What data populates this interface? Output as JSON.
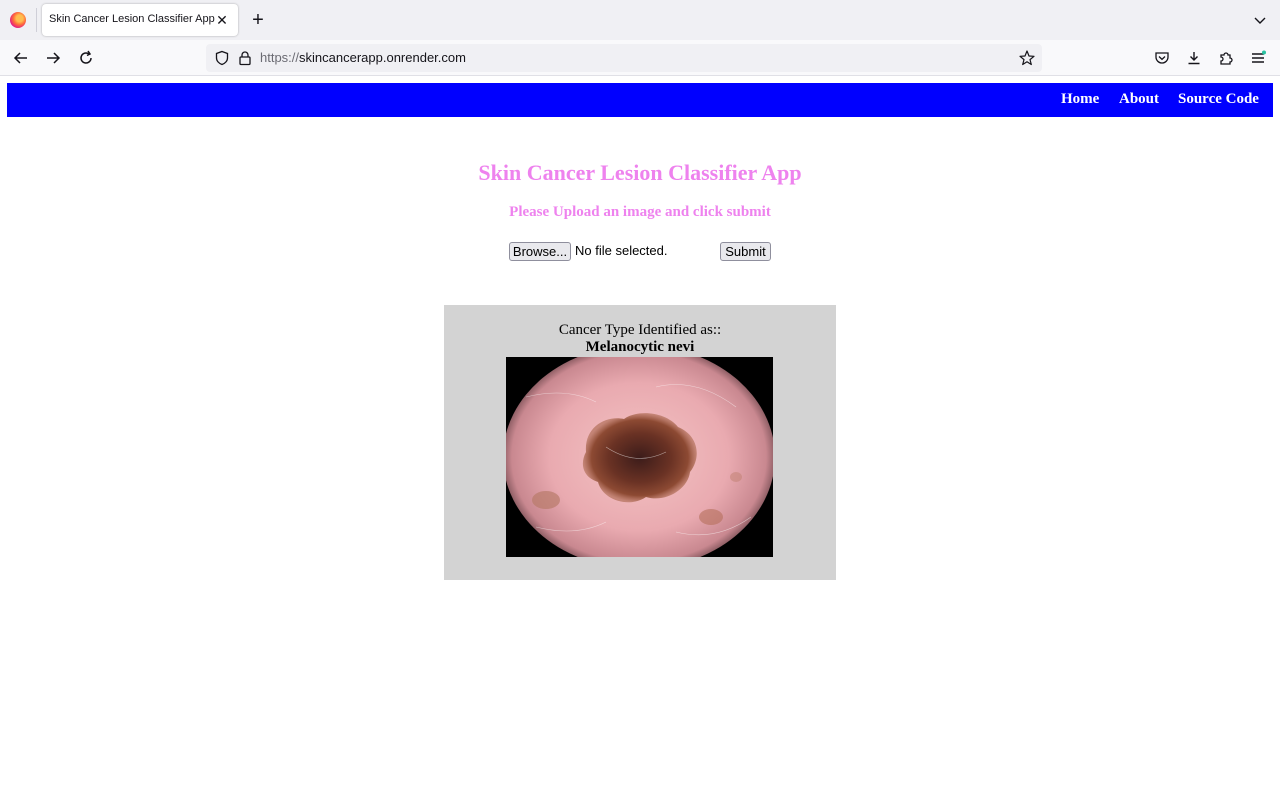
{
  "browser": {
    "tab_title": "Skin Cancer Lesion Classifier App",
    "url_scheme": "https://",
    "url_host": "skincancerapp.onrender.com"
  },
  "nav": {
    "home": "Home",
    "about": "About",
    "source_code": "Source Code",
    "bar_color": "#0000ff"
  },
  "main": {
    "title": "Skin Cancer Lesion Classifier App",
    "subtitle": "Please Upload an image and click submit",
    "browse_label": "Browse...",
    "file_status": "No file selected.",
    "submit_label": "Submit",
    "heading_color": "#ee82ee"
  },
  "result": {
    "label": "Cancer Type Identified as::",
    "value": "Melanocytic nevi"
  }
}
